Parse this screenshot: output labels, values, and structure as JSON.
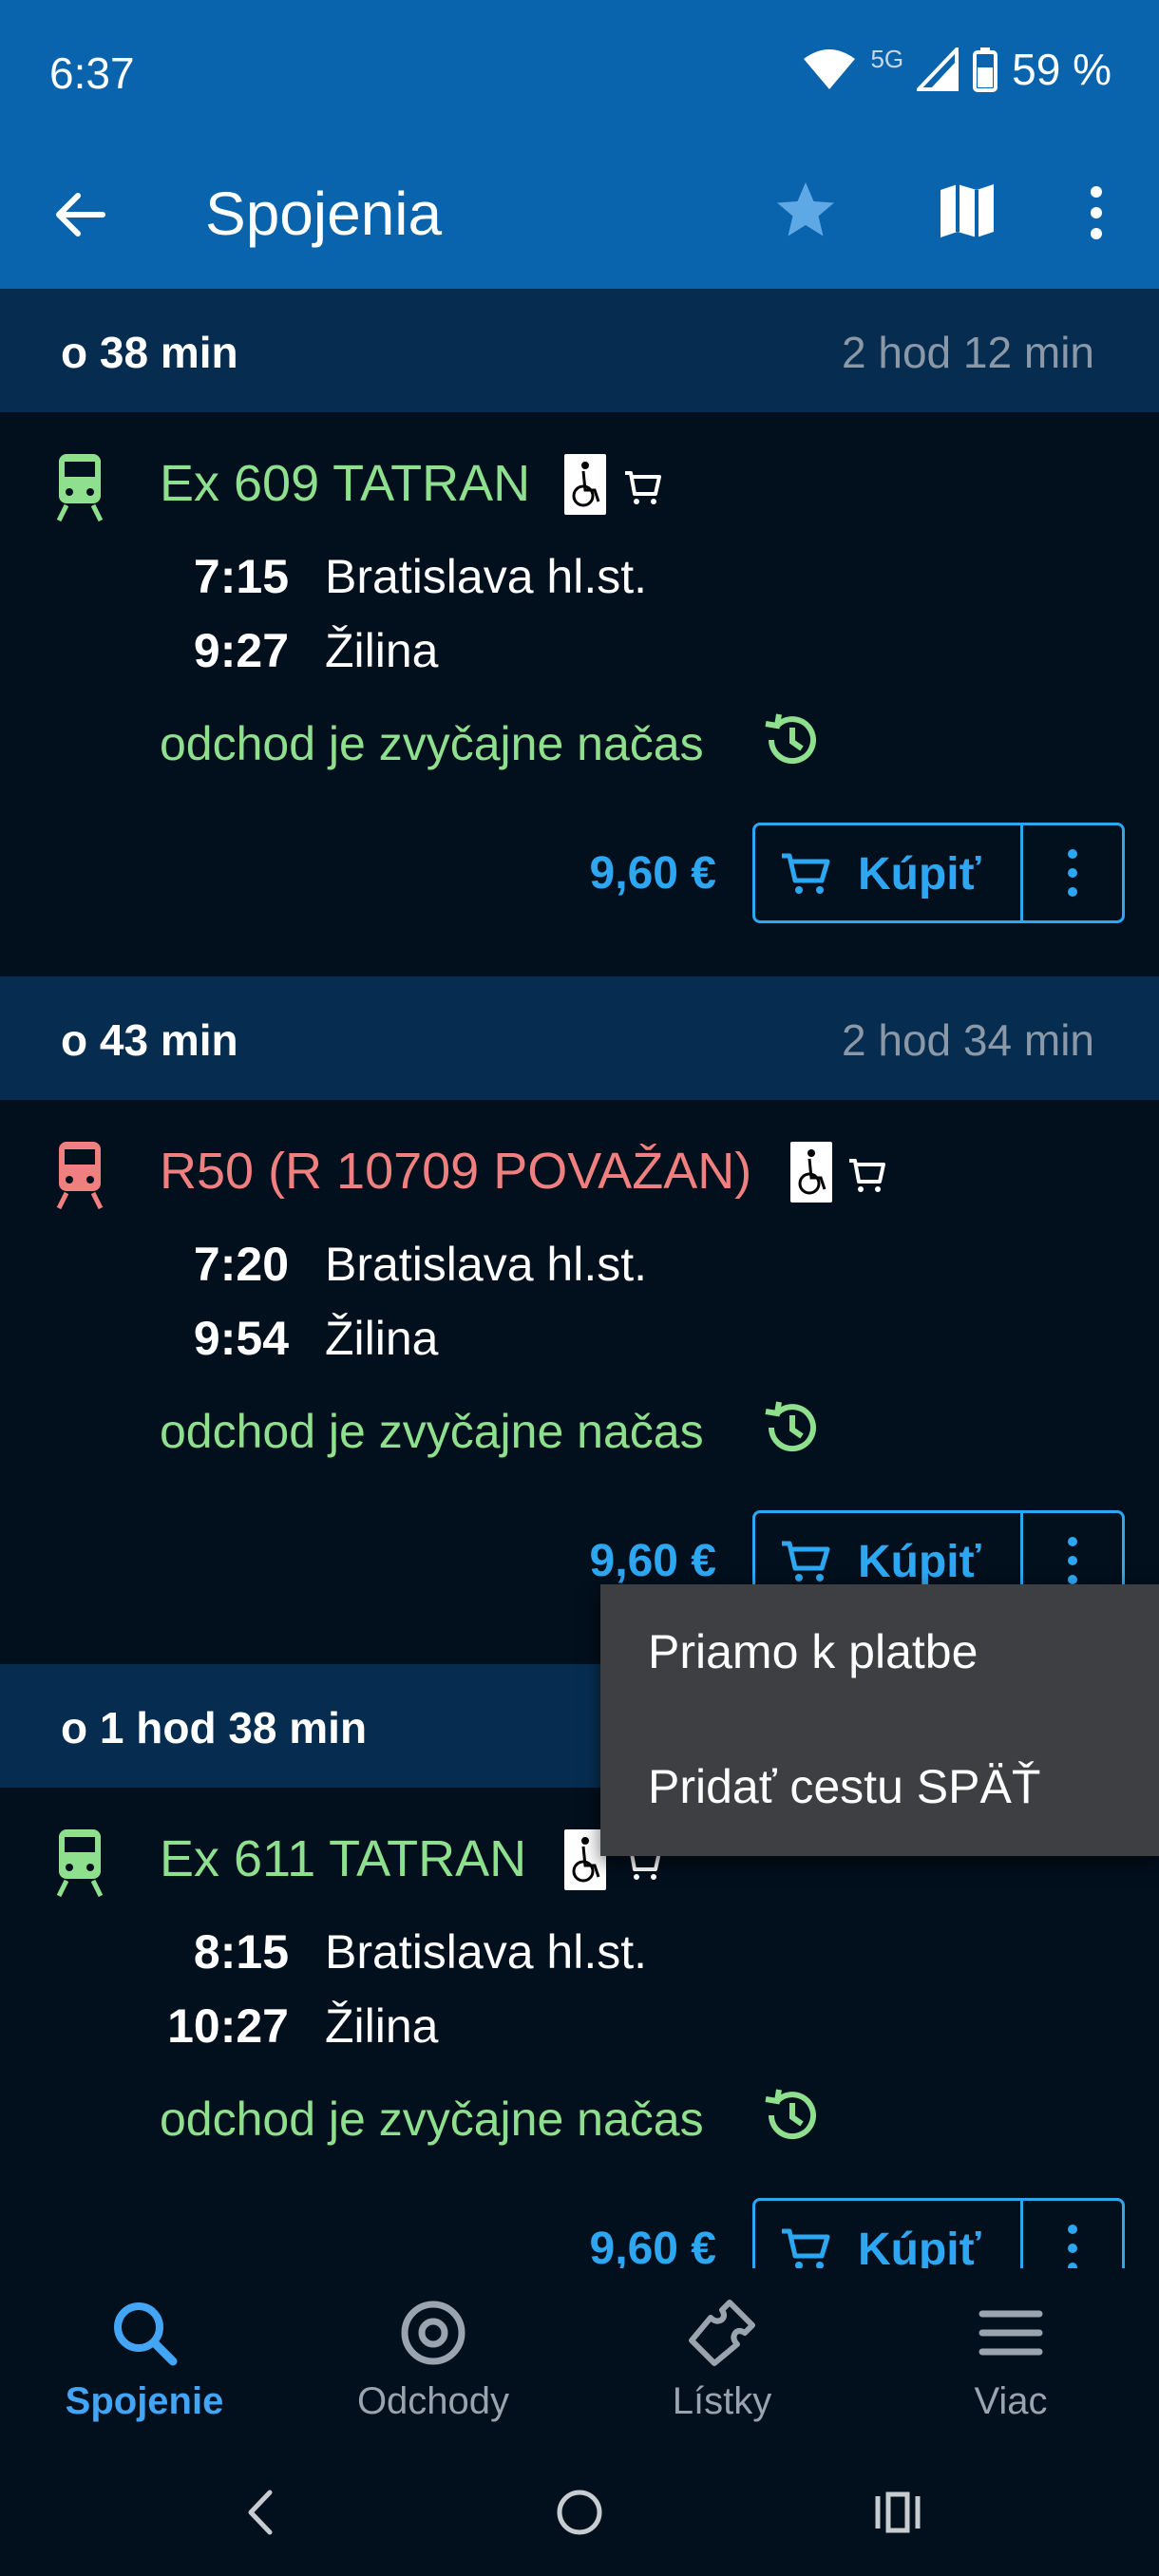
{
  "status": {
    "time": "6:37",
    "network": "5G",
    "battery": "59 %"
  },
  "appbar": {
    "title": "Spojenia"
  },
  "connections": [
    {
      "from": "o 38 min",
      "duration": "2 hod 12 min",
      "train": "Ex 609 TATRAN",
      "color": "#8ee08e",
      "dep_time": "7:15",
      "dep_station": "Bratislava hl.st.",
      "arr_time": "9:27",
      "arr_station": "Žilina",
      "punctuality": "odchod je zvyčajne načas",
      "price": "9,60 €",
      "buy_label": "Kúpiť"
    },
    {
      "from": "o 43 min",
      "duration": "2 hod 34 min",
      "train": "R50 (R 10709 POVAŽAN)",
      "color": "#f07f7f",
      "dep_time": "7:20",
      "dep_station": "Bratislava hl.st.",
      "arr_time": "9:54",
      "arr_station": "Žilina",
      "punctuality": "odchod je zvyčajne načas",
      "price": "9,60 €",
      "buy_label": "Kúpiť"
    },
    {
      "from": "o 1 hod 38 min",
      "duration": "",
      "train": "Ex 611 TATRAN",
      "color": "#8ee08e",
      "dep_time": "8:15",
      "dep_station": "Bratislava hl.st.",
      "arr_time": "10:27",
      "arr_station": "Žilina",
      "punctuality": "odchod je zvyčajne načas",
      "price": "9,60 €",
      "buy_label": "Kúpiť"
    }
  ],
  "popup": {
    "items": [
      "Priamo k platbe",
      "Pridať cestu SPÄŤ"
    ]
  },
  "bottom_nav": [
    {
      "label": "Spojenie",
      "icon": "search-icon",
      "active": true
    },
    {
      "label": "Odchody",
      "icon": "target-icon",
      "active": false
    },
    {
      "label": "Lístky",
      "icon": "ticket-icon",
      "active": false
    },
    {
      "label": "Viac",
      "icon": "menu-icon",
      "active": false
    }
  ],
  "colors": {
    "primary": "#0a64ad",
    "header": "#062d50",
    "accent": "#2ea7f2",
    "ontime": "#8ee08e",
    "delayed_train": "#f07f7f",
    "background": "#020f1c"
  }
}
